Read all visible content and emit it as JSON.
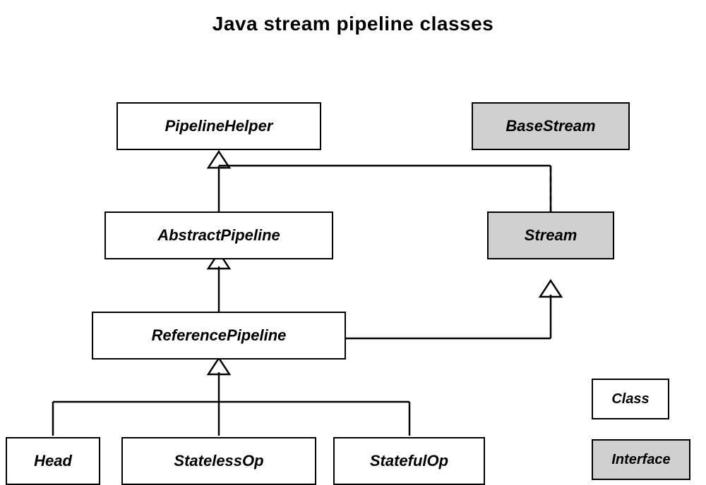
{
  "title": "Java stream pipeline classes",
  "boxes": {
    "pipelineHelper": {
      "label": "PipelineHelper",
      "type": "class"
    },
    "baseStream": {
      "label": "BaseStream",
      "type": "interface"
    },
    "abstractPipeline": {
      "label": "AbstractPipeline",
      "type": "class"
    },
    "stream": {
      "label": "Stream",
      "type": "interface"
    },
    "referencePipeline": {
      "label": "ReferencePipeline",
      "type": "class"
    },
    "head": {
      "label": "Head",
      "type": "class"
    },
    "statelessOp": {
      "label": "StatelessOp",
      "type": "class"
    },
    "statefulOp": {
      "label": "StatefulOp",
      "type": "class"
    }
  },
  "legend": {
    "classLabel": "Class",
    "interfaceLabel": "Interface"
  }
}
